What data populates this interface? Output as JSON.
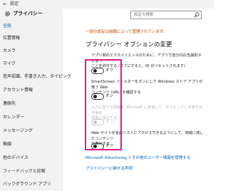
{
  "window": {
    "back_glyph": "←",
    "title": "設定"
  },
  "sidebar": {
    "header": "プライバシー",
    "items": [
      {
        "label": "全般",
        "active": true
      },
      {
        "label": "位置情報",
        "active": false
      },
      {
        "label": "カメラ",
        "active": false
      },
      {
        "label": "マイク",
        "active": false
      },
      {
        "label": "音声認識、手書き入力、タイピング",
        "active": false
      },
      {
        "label": "アカウント情報",
        "active": false
      },
      {
        "label": "連絡先",
        "active": false
      },
      {
        "label": "カレンダー",
        "active": false
      },
      {
        "label": "メッセージング",
        "active": false
      },
      {
        "label": "無線",
        "active": false
      },
      {
        "label": "他のデバイス",
        "active": false
      },
      {
        "label": "フィードバックと診断",
        "active": false
      },
      {
        "label": "バックグラウンド アプリ",
        "active": false
      }
    ]
  },
  "search": {
    "placeholder": "設定の検索"
  },
  "main": {
    "notice": "一部の設定は組織によって管理されています。",
    "title": "プライバシー オプションの変更",
    "options": [
      {
        "description_lines": [
          "アプリ間のエクスペリエンスのために、アプリで自分の広告識別子を使う",
          "ことを許可する (オフにすると、ID がリセットされます)"
        ],
        "state": "オフ",
        "disabled": false
      },
      {
        "description_lines": [
          "SmartScreen フィルターをオンにして Windows ストア アプリが使う Web",
          "コンテンツ (URL) を確認する"
        ],
        "state": "オン",
        "disabled": false
      },
      {
        "description_lines": [
          "入力に関する情報を Microsoft に送信して、タイピングと手書きの今後の",
          "改善に役立てる"
        ],
        "state": "オフ",
        "disabled": true
      },
      {
        "description_lines": [
          "Web サイトが言語リストにアクセスできるようにして、地域に適したコンテンツ",
          "を表示する"
        ],
        "state": "オフ",
        "disabled": false
      }
    ],
    "links": [
      "Microsoft Advertising とその他のユーザー情報を管理する",
      "プライバシーに関する声明"
    ]
  },
  "colors": {
    "accent": "#0063b1",
    "notice": "#c64a00",
    "highlight": "#e0198a"
  }
}
